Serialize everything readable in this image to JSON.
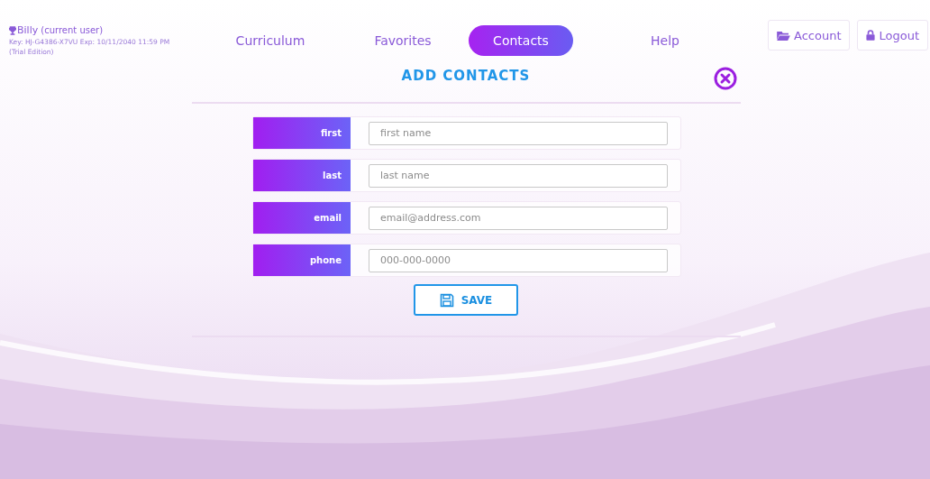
{
  "user": {
    "name": "Billy",
    "role": "(current user)",
    "key_line": "Key: HJ-G4386-X7VU Exp: 10/11/2040 11:59 PM",
    "edition": "(Trial Edition)"
  },
  "nav": [
    {
      "label": "Curriculum",
      "selected": false
    },
    {
      "label": "Favorites",
      "selected": false
    },
    {
      "label": "Contacts",
      "selected": true
    },
    {
      "label": "Help",
      "selected": false
    }
  ],
  "header_buttons": [
    {
      "kind": "folder",
      "label": "Account"
    },
    {
      "kind": "lock",
      "label": "Logout"
    }
  ],
  "dialog": {
    "title": "ADD CONTACTS",
    "fields": [
      {
        "label": "first",
        "placeholder": "first name"
      },
      {
        "label": "last",
        "placeholder": "last name"
      },
      {
        "label": "email",
        "placeholder": "email@address.com"
      },
      {
        "label": "phone",
        "placeholder": "000-000-0000"
      }
    ],
    "save_button": "SAVE"
  }
}
